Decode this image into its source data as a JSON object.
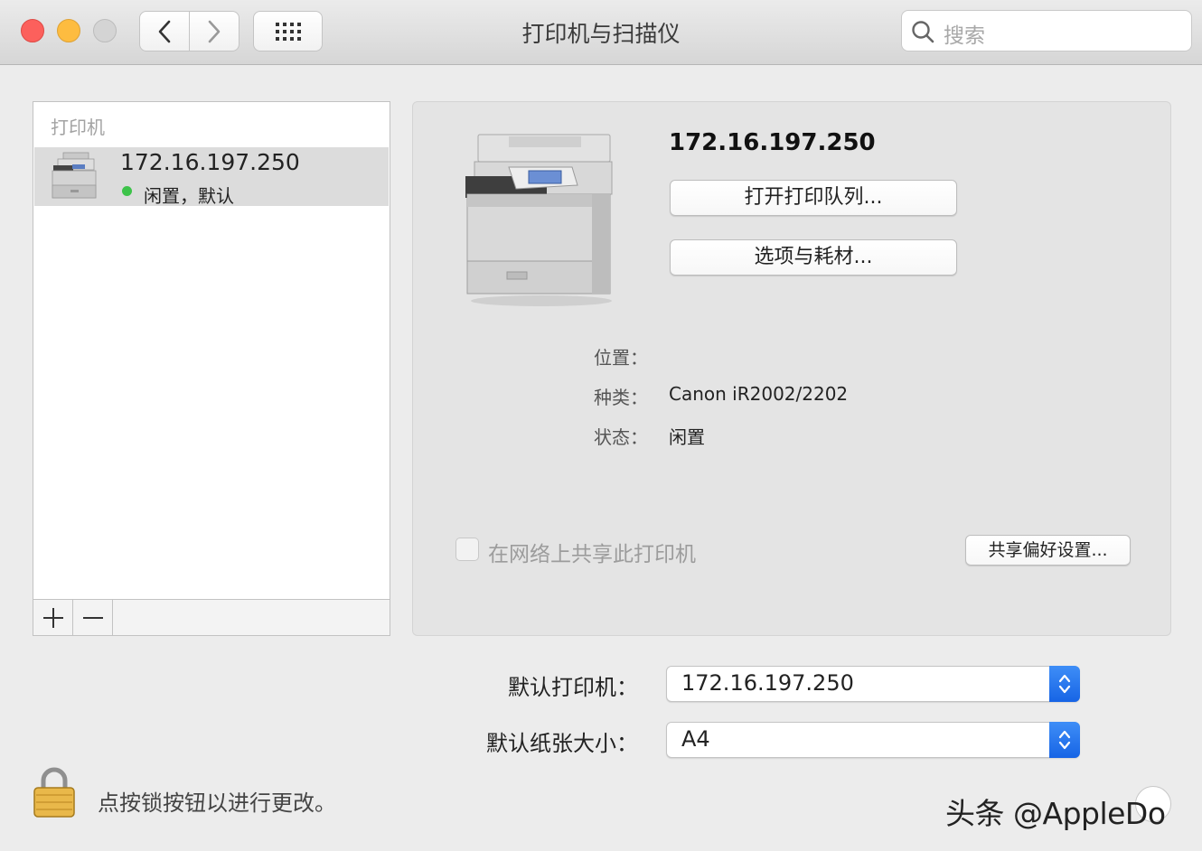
{
  "window": {
    "title": "打印机与扫描仪",
    "search_placeholder": "搜索"
  },
  "printer_list": {
    "header": "打印机",
    "items": [
      {
        "name": "172.16.197.250",
        "status": "闲置，默认",
        "status_color": "#3dc34a"
      }
    ],
    "add_label": "+",
    "remove_label": "−"
  },
  "detail": {
    "name": "172.16.197.250",
    "open_queue_button": "打开打印队列...",
    "options_button": "选项与耗材...",
    "location_label": "位置：",
    "location_value": "",
    "kind_label": "种类：",
    "kind_value": "Canon iR2002/2202",
    "status_label": "状态：",
    "status_value": "闲置",
    "share_checkbox_label": "在网络上共享此打印机",
    "share_checked": false,
    "sharing_prefs_button": "共享偏好设置..."
  },
  "defaults": {
    "default_printer_label": "默认打印机：",
    "default_printer_value": "172.16.197.250",
    "default_paper_label": "默认纸张大小：",
    "default_paper_value": "A4"
  },
  "lock": {
    "text": "点按锁按钮以进行更改。"
  },
  "watermark": "头条 @AppleDo",
  "colors": {
    "accent": "#1f6fea",
    "close": "#fc605c",
    "minimize": "#fdbc40"
  }
}
